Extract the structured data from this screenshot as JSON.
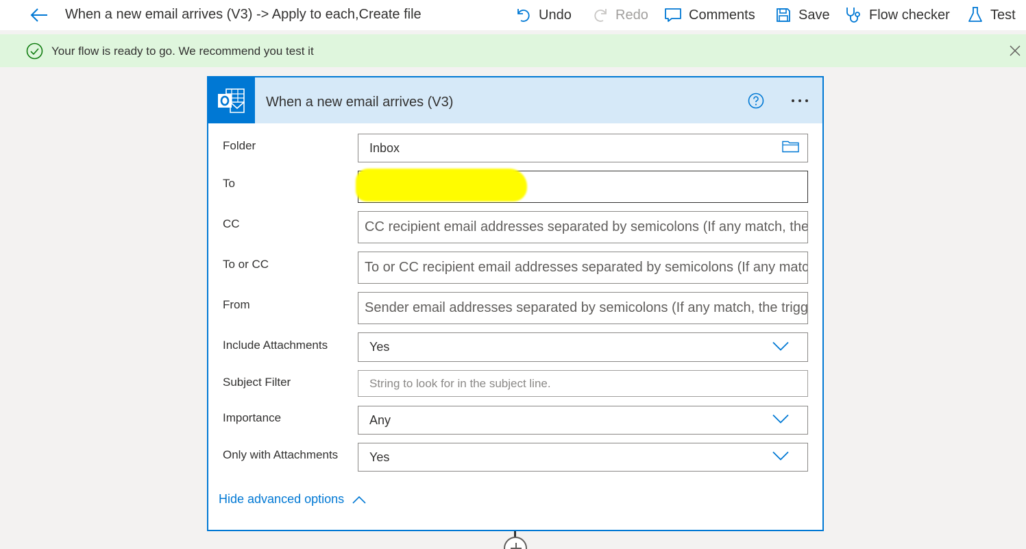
{
  "commandbar": {
    "title": "When a new email arrives (V3) -> Apply to each,Create file",
    "undo": "Undo",
    "redo": "Redo",
    "comments": "Comments",
    "save": "Save",
    "flow_checker": "Flow checker",
    "test": "Test"
  },
  "banner": {
    "message": "Your flow is ready to go. We recommend you test it"
  },
  "card": {
    "title": "When a new email arrives (V3)",
    "fields": {
      "folder": {
        "label": "Folder",
        "value": "Inbox"
      },
      "to": {
        "label": "To",
        "value": ""
      },
      "cc": {
        "label": "CC",
        "placeholder": "CC recipient email addresses separated by semicolons (If any match, the trigger will run)"
      },
      "to_or_cc": {
        "label": "To or CC",
        "placeholder": "To or CC recipient email addresses separated by semicolons (If any match, the trigger will run)"
      },
      "from": {
        "label": "From",
        "placeholder": "Sender email addresses separated by semicolons (If any match, the trigger will run)"
      },
      "include_attachments": {
        "label": "Include Attachments",
        "value": "Yes"
      },
      "subject_filter": {
        "label": "Subject Filter",
        "placeholder": "String to look for in the subject line."
      },
      "importance": {
        "label": "Importance",
        "value": "Any"
      },
      "only_with_attachments": {
        "label": "Only with Attachments",
        "value": "Yes"
      }
    },
    "advanced_toggle": "Hide advanced options"
  },
  "colors": {
    "accent": "#0078d4",
    "banner_bg": "#dff6dd",
    "success": "#107c10",
    "header_bg": "#d6e9f8",
    "redaction": "#fffc00"
  },
  "icons": {
    "back": "arrow-left-icon",
    "undo": "undo-icon",
    "redo": "redo-icon",
    "comments": "comment-icon",
    "save": "save-icon",
    "flow_checker": "stethoscope-icon",
    "test": "flask-icon",
    "banner_status": "check-circle-icon",
    "banner_close": "close-icon",
    "connector": "outlook-logo-icon",
    "help": "help-circle-icon",
    "more": "more-icon",
    "folder_picker": "folder-icon",
    "dropdown": "chevron-down-icon",
    "collapse": "chevron-up-icon",
    "add_step": "plus-icon"
  }
}
